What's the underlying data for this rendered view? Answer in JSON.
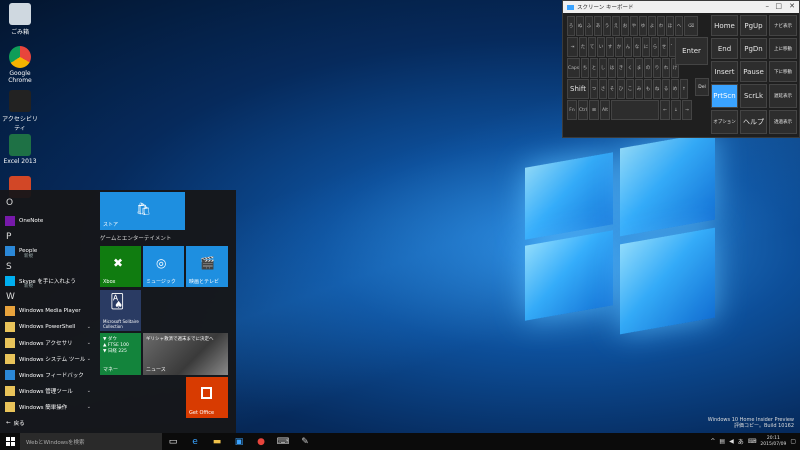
{
  "desktop": {
    "icons": [
      {
        "label": "ごみ箱",
        "color": "#cfd8e0"
      },
      {
        "label": "Google Chrome",
        "color": "#e8453c"
      },
      {
        "label": "アクセシビリティ",
        "color": "#222"
      },
      {
        "label": "Excel 2013",
        "color": "#1e7145"
      },
      {
        "label": "",
        "color": "#d24726"
      }
    ]
  },
  "start_menu": {
    "letters": [
      "O",
      "P",
      "S",
      "W"
    ],
    "apps": [
      {
        "label": "OneNote",
        "sub": "",
        "color": "#7719aa"
      },
      {
        "label": "People",
        "sub": "新規",
        "color": "#2b88d8"
      },
      {
        "label": "Skype を手に入れよう",
        "sub": "新規",
        "color": "#00aff0"
      },
      {
        "label": "Windows Media Player",
        "sub": "",
        "color": "#e8a33d"
      },
      {
        "label": "Windows PowerShell",
        "sub": "",
        "color": "#e8c35a"
      },
      {
        "label": "Windows アクセサリ",
        "sub": "",
        "color": "#e8c35a"
      },
      {
        "label": "Windows システム ツール",
        "sub": "",
        "color": "#e8c35a"
      },
      {
        "label": "Windows フィードバック",
        "sub": "",
        "color": "#2b88d8"
      },
      {
        "label": "Windows 管理ツール",
        "sub": "",
        "color": "#e8c35a"
      },
      {
        "label": "Windows 簡単操作",
        "sub": "",
        "color": "#e8c35a"
      }
    ],
    "back_label": "戻る",
    "group_label": "ゲームとエンターテイメント",
    "tiles": {
      "store": "ストア",
      "xbox": "Xbox",
      "music": "ミュージック",
      "movies": "映画とテレビ",
      "solitaire": "Microsoft Solitaire Collection",
      "money_lines": [
        "▼ ダウ",
        "▲ FTSE 100",
        "▼ 日経 225"
      ],
      "money": "マネー",
      "news_headline": "ギリシャ救済で週末までに決定へ",
      "news": "ニュース",
      "office": "Get Office"
    }
  },
  "osk": {
    "title": "スクリーン キーボード",
    "keys": {
      "enter": "Enter",
      "shift": "Shift",
      "del": "Del",
      "home": "Home",
      "pgup": "PgUp",
      "navi": "ナビ表示",
      "end": "End",
      "pgdn": "PgDn",
      "up": "上に移動",
      "insert": "Insert",
      "pause": "Pause",
      "down": "下に移動",
      "prtscn": "PrtScn",
      "scrlk": "ScrLk",
      "fade": "遅延表示",
      "options": "オプション",
      "help": "ヘルプ",
      "transparency": "透過表示"
    }
  },
  "watermark": {
    "line1": "Windows 10 Home Insider Preview",
    "line2": "評価コピー。Build 10162"
  },
  "taskbar": {
    "search_placeholder": "WebとWindowsを検索",
    "time": "20:11",
    "date": "2015/07/09"
  }
}
